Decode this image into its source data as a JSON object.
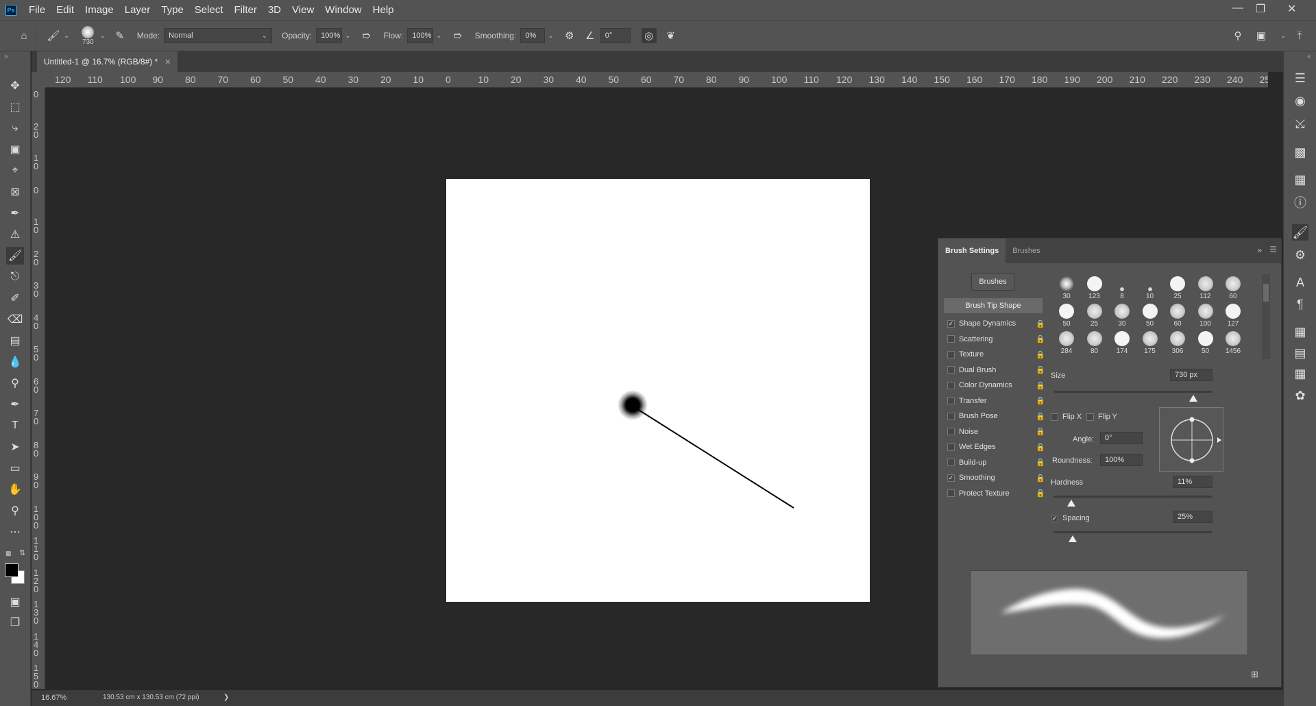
{
  "app": {
    "logo": "Ps"
  },
  "menu": [
    "File",
    "Edit",
    "Image",
    "Layer",
    "Type",
    "Select",
    "Filter",
    "3D",
    "View",
    "Window",
    "Help"
  ],
  "options": {
    "brush_size": "730",
    "mode_label": "Mode:",
    "mode_value": "Normal",
    "opacity_label": "Opacity:",
    "opacity_value": "100%",
    "flow_label": "Flow:",
    "flow_value": "100%",
    "smoothing_label": "Smoothing:",
    "smoothing_value": "0%",
    "angle_value": "0°"
  },
  "document": {
    "tab_title": "Untitled-1 @ 16.7% (RGB/8#) *",
    "ruler_h_labels": [
      "120",
      "110",
      "100",
      "90",
      "80",
      "70",
      "60",
      "50",
      "40",
      "30",
      "20",
      "10",
      "0",
      "10",
      "20",
      "30",
      "40",
      "50",
      "60",
      "70",
      "80",
      "90",
      "100",
      "110",
      "120",
      "130",
      "140",
      "150",
      "160",
      "170",
      "180",
      "190",
      "200",
      "210",
      "220",
      "230",
      "240",
      "25"
    ],
    "ruler_v_labels": [
      "0",
      "2 0",
      "1 0",
      "0",
      "1 0",
      "2 0",
      "3 0",
      "4 0",
      "5 0",
      "6 0",
      "7 0",
      "8 0",
      "9 0",
      "1 0 0",
      "1 1 0",
      "1 2 0",
      "1 3 0",
      "1 4 0",
      "1 5 0"
    ]
  },
  "status": {
    "zoom": "16.67%",
    "doc_size": "130.53 cm x 130.53 cm (72 ppi)",
    "arrow": "❯"
  },
  "brush_panel": {
    "tab_settings": "Brush Settings",
    "tab_brushes": "Brushes",
    "brushes_button": "Brushes",
    "tip_shape": "Brush Tip Shape",
    "options": [
      {
        "label": "Shape Dynamics",
        "checked": true
      },
      {
        "label": "Scattering",
        "checked": false
      },
      {
        "label": "Texture",
        "checked": false
      },
      {
        "label": "Dual Brush",
        "checked": false
      },
      {
        "label": "Color Dynamics",
        "checked": false
      },
      {
        "label": "Transfer",
        "checked": false
      },
      {
        "label": "Brush Pose",
        "checked": false
      },
      {
        "label": "Noise",
        "checked": false
      },
      {
        "label": "Wet Edges",
        "checked": false
      },
      {
        "label": "Build-up",
        "checked": false
      },
      {
        "label": "Smoothing",
        "checked": true
      },
      {
        "label": "Protect Texture",
        "checked": false
      }
    ],
    "tips": [
      "30",
      "123",
      "8",
      "10",
      "25",
      "112",
      "60",
      "50",
      "25",
      "30",
      "50",
      "60",
      "100",
      "127",
      "284",
      "80",
      "174",
      "175",
      "306",
      "50",
      "1456"
    ],
    "size_label": "Size",
    "size_value": "730 px",
    "size_fraction": 0.88,
    "flip_x": "Flip X",
    "flip_y": "Flip Y",
    "angle_label": "Angle:",
    "angle_value": "0°",
    "roundness_label": "Roundness:",
    "roundness_value": "100%",
    "hardness_label": "Hardness",
    "hardness_value": "11%",
    "hardness_fraction": 0.11,
    "spacing_label": "Spacing",
    "spacing_value": "25%",
    "spacing_fraction": 0.12
  }
}
